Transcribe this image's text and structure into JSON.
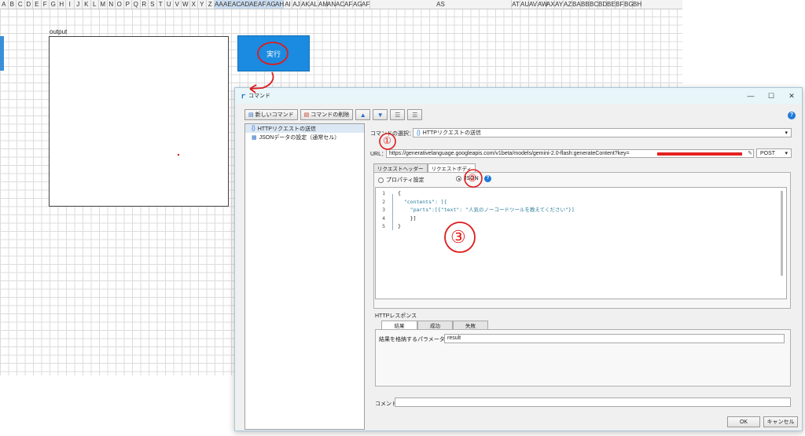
{
  "sheet": {
    "columns": [
      "A",
      "B",
      "C",
      "D",
      "E",
      "F",
      "G",
      "H",
      "I",
      "J",
      "K",
      "L",
      "M",
      "N",
      "O",
      "P",
      "Q",
      "R",
      "S",
      "T",
      "U",
      "V",
      "W",
      "X",
      "Y",
      "Z",
      "AA",
      "AE",
      "AC",
      "AD",
      "AE",
      "AF",
      "AG",
      "AH",
      "AI",
      "AJ",
      "AK",
      "AL",
      "AM",
      "AN",
      "AC",
      "AF",
      "AG",
      "AF",
      "AS",
      "AT",
      "AU",
      "AV",
      "AW",
      "AX",
      "AY",
      "AZ",
      "BA",
      "BB",
      "BC",
      "BD",
      "BE",
      "BF",
      "BG",
      "BH"
    ],
    "output_label": "output",
    "run_button_label": "実行"
  },
  "dialog": {
    "title": "コマンド",
    "toolbar": {
      "new_command": "新しいコマンド",
      "delete_command": "コマンドの削除"
    },
    "tree": [
      {
        "label": "HTTPリクエストの送信",
        "icon": "http-request-icon"
      },
      {
        "label": "JSONデータの設定（通常セル）",
        "icon": "json-data-icon"
      }
    ],
    "command_select": {
      "label": "コマンドの選択：",
      "value": "HTTPリクエストの送信"
    },
    "url": {
      "label": "URL：",
      "value": "https://generativelanguage.googleapis.com/v1beta/models/gemini-2.0-flash:generateContent?key=",
      "method": "POST"
    },
    "request_tabs": [
      "リクエストヘッダー",
      "リクエストボディ"
    ],
    "body_mode": {
      "property": "プロパティ設定",
      "json": "JSON",
      "selected": "JSON"
    },
    "code_lines": [
      {
        "n": "1",
        "text": "{"
      },
      {
        "n": "2",
        "text": "  \"contents\": [{"
      },
      {
        "n": "3",
        "text": "    \"parts\":[{\"text\": \"人気のノーコードツールを教えてください\"}]"
      },
      {
        "n": "4",
        "text": "    }]"
      },
      {
        "n": "5",
        "text": "}"
      }
    ],
    "response": {
      "title": "HTTPレスポンス",
      "tabs": [
        "結果",
        "成功",
        "失敗"
      ],
      "param_label": "結果を格納するパラメーター名：",
      "param_value": "result"
    },
    "comment_label": "コメント",
    "ok_label": "OK",
    "cancel_label": "キャンセル"
  },
  "annotations": [
    "①",
    "②",
    "③"
  ],
  "colors": {
    "accent": "#1a8be0",
    "annotation": "#e01b1b"
  }
}
